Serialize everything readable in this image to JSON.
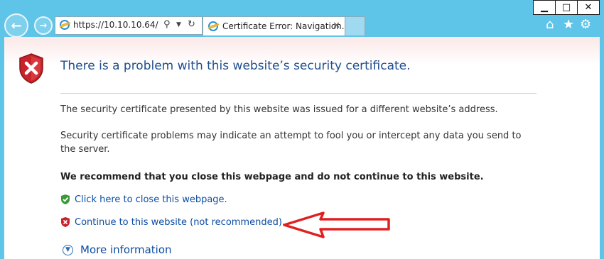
{
  "browser": {
    "address": {
      "url": "https://10.10.10.64/",
      "search_icon": "magnifier-icon",
      "dropdown_icon": "caret-down-icon",
      "refresh_icon": "refresh-icon"
    },
    "tab": {
      "title": "Certificate Error: Navigation...",
      "close": "✕"
    },
    "window_controls": {
      "minimize": "▁",
      "maximize": "□",
      "close": "✕"
    },
    "toolbar_icons": [
      "home-icon",
      "star-icon",
      "gear-icon"
    ]
  },
  "page": {
    "title": "There is a problem with this website’s security certificate.",
    "paragraph1": "The security certificate presented by this website was issued for a different website’s address.",
    "paragraph2": "Security certificate problems may indicate an attempt to fool you or intercept any data you send to the server.",
    "recommendation": "We recommend that you close this webpage and do not continue to this website.",
    "close_link": "Click here to close this webpage.",
    "continue_link": "Continue to this website (not recommended).",
    "more_info": "More information"
  },
  "colors": {
    "chrome": "#5ec4e8",
    "title": "#1f4e8f",
    "link": "#0b4da2",
    "annotation_arrow": "#e02020"
  }
}
